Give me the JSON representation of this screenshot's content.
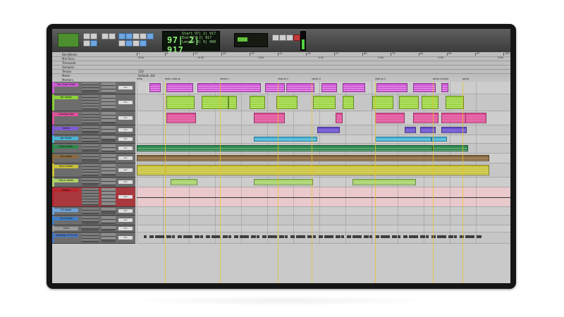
{
  "app": "Pro Tools Edit Window",
  "toolbar": {
    "counter_main": "97| 2| 917",
    "counter_side": [
      "Start",
      "End",
      "Length"
    ],
    "counter_values": [
      "97| 2| 917",
      "97| 2| 917",
      "0| 0| 000"
    ],
    "grid_label": "Grid",
    "nudge_label": "Nudge",
    "nudge_value": "0| 0| 240"
  },
  "rulers": {
    "rows": [
      "Bars|Beats",
      "Min:Secs",
      "Timecode",
      "Samples",
      "Tempo",
      "Meter",
      "Key",
      "Markers"
    ],
    "bar_ticks": [
      "1",
      "9",
      "17",
      "25",
      "33",
      "41",
      "49",
      "57",
      "65",
      "73",
      "81",
      "89",
      "97",
      "105"
    ],
    "min_ticks": [
      "0:00",
      "0:30",
      "1:00",
      "1:30",
      "2:00",
      "2:30",
      "3:00"
    ],
    "tempo": "120",
    "meter": "Default: 4/4",
    "key": "C major",
    "markers": [
      "intro",
      "main chorus",
      "verse 1",
      "chorus 1",
      "verse 2",
      "chorus 2",
      "outro chorus",
      "outro"
    ]
  },
  "tracks": [
    {
      "name": "Vox Lead folder",
      "color": "#d25bd8",
      "volume": "0.0"
    },
    {
      "name": "BG folder",
      "color": "#8bd13b",
      "volume": "0.0"
    },
    {
      "name": "Floating Vox",
      "color": "#e0509a",
      "volume": "0.0"
    },
    {
      "name": "Adlibs",
      "color": "#7f5bd6",
      "volume": "0.0"
    },
    {
      "name": "gtr folder",
      "color": "#48b6d8",
      "volume": "0.0"
    },
    {
      "name": "Bass folder",
      "color": "#2f8a4f",
      "volume": "0.0"
    },
    {
      "name": "Gtr folder",
      "color": "#8a6a3d",
      "volume": "0.0"
    },
    {
      "name": "Keys folder",
      "color": "#c9c23a",
      "volume": "0.0"
    },
    {
      "name": "Horns folder",
      "color": "#b0d36a",
      "volume": "0.0"
    },
    {
      "name": "Master",
      "color": "#b8262f",
      "volume": "0.0"
    },
    {
      "name": "FX folder",
      "color": "#6fa3d9",
      "volume": "0.0"
    },
    {
      "name": "VCA folder",
      "color": "#3f7fc9",
      "volume": "0.0"
    },
    {
      "name": "Click",
      "color": "#9a9a9a",
      "volume": "0.0"
    },
    {
      "name": "Mixdown 071218",
      "color": "#4a78c0",
      "volume": "0.0"
    }
  ],
  "colors": {
    "vox": "#d25bd8",
    "bg": "#9bd43e",
    "floating": "#e0509a",
    "adlibs": "#6a4fd0",
    "gtr": "#48b6d8",
    "bass": "#2f8a4f",
    "gtr2": "#8a6a3d",
    "keys": "#c9c23a",
    "horns": "#a6d36a",
    "master": "#b8262f"
  }
}
